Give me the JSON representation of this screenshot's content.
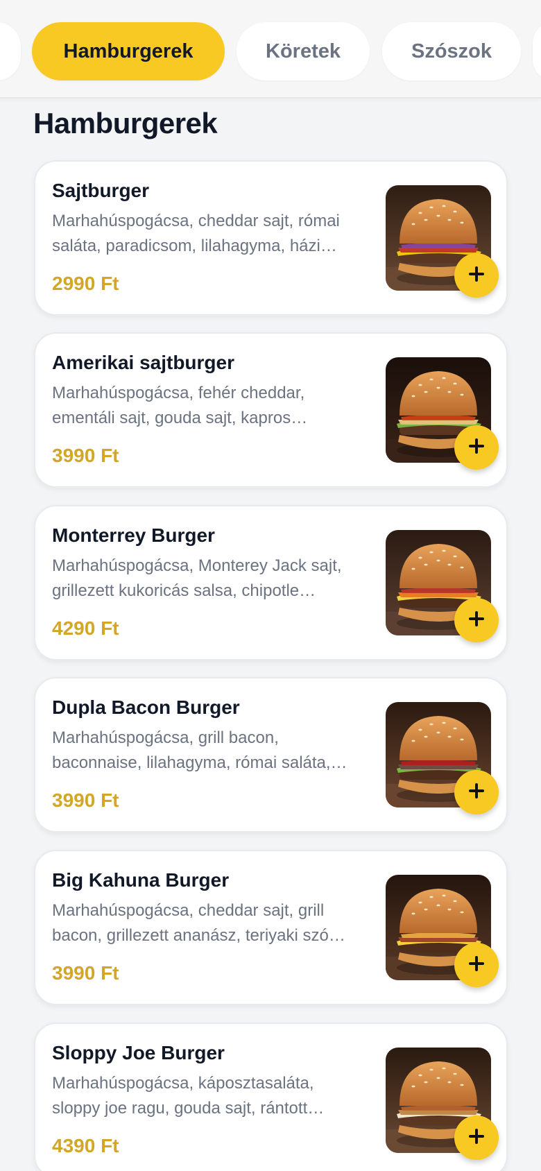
{
  "tabs": [
    {
      "label": "",
      "active": false
    },
    {
      "label": "Hamburgerek",
      "active": true
    },
    {
      "label": "Köretek",
      "active": false
    },
    {
      "label": "Szószok",
      "active": false
    },
    {
      "label": "",
      "active": false
    }
  ],
  "section": {
    "title": "Hamburgerek"
  },
  "items": [
    {
      "name": "Sajtburger",
      "description": "Marhahúspogácsa, cheddar sajt, római saláta, paradicsom, lilahagyma, házi…",
      "price": "2990 Ft",
      "image_icon": "burger-photo"
    },
    {
      "name": "Amerikai sajtburger",
      "description": "Marhahúspogácsa, fehér cheddar, ementáli sajt, gouda sajt, kapros…",
      "price": "3990 Ft",
      "image_icon": "burger-photo"
    },
    {
      "name": "Monterrey Burger",
      "description": "Marhahúspogácsa, Monterey Jack sajt, grillezett kukoricás salsa, chipotle…",
      "price": "4290 Ft",
      "image_icon": "burger-photo"
    },
    {
      "name": "Dupla Bacon Burger",
      "description": "Marhahúspogácsa, grill bacon, baconnaise, lilahagyma, római saláta,…",
      "price": "3990 Ft",
      "image_icon": "burger-photo"
    },
    {
      "name": "Big Kahuna Burger",
      "description": "Marhahúspogácsa, cheddar sajt, grill bacon, grillezett ananász, teriyaki szó…",
      "price": "3990 Ft",
      "image_icon": "burger-photo"
    },
    {
      "name": "Sloppy Joe Burger",
      "description": "Marhahúspogácsa, káposztasaláta, sloppy joe ragu, gouda sajt, rántott…",
      "price": "4390 Ft",
      "image_icon": "burger-photo"
    }
  ],
  "colors": {
    "accent": "#f9c923",
    "price": "#d4a628",
    "background": "#f3f4f6"
  }
}
